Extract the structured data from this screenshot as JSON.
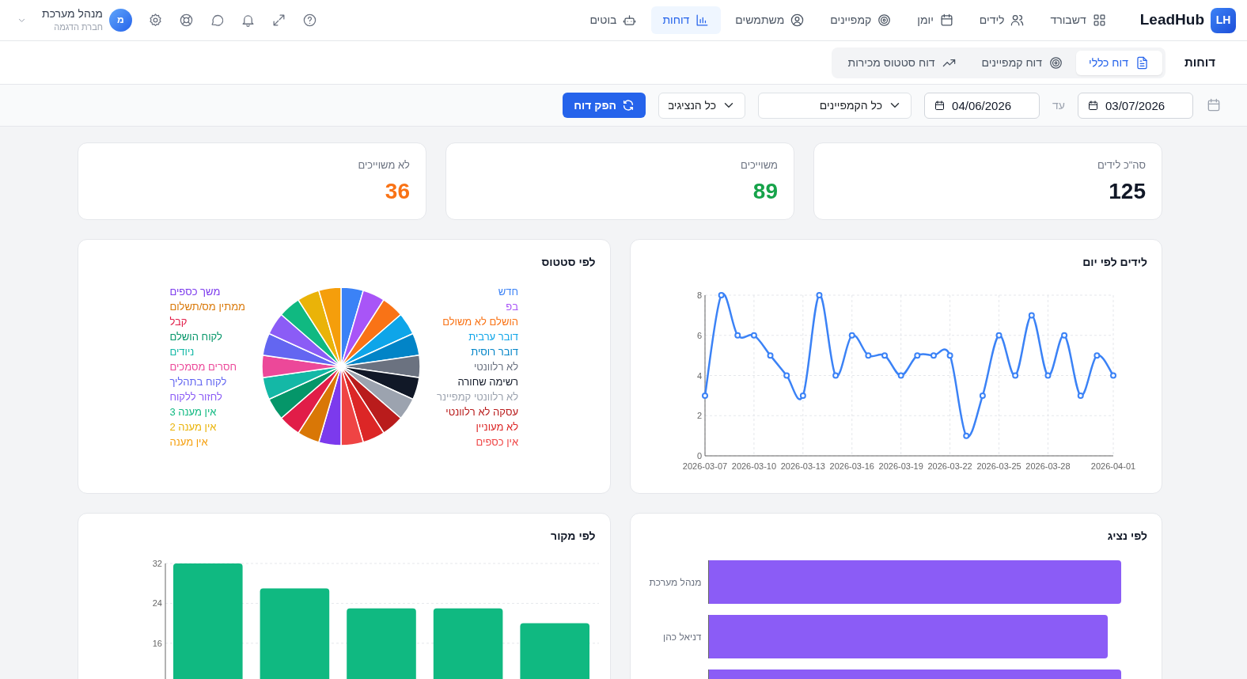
{
  "brand": {
    "badge": "LH",
    "name": "LeadHub"
  },
  "nav": [
    {
      "label": "דשבורד",
      "selected": false
    },
    {
      "label": "לידים",
      "selected": false
    },
    {
      "label": "יומן",
      "selected": false
    },
    {
      "label": "קמפיינים",
      "selected": false
    },
    {
      "label": "משתמשים",
      "selected": false
    },
    {
      "label": "דוחות",
      "selected": true
    },
    {
      "label": "בוטים",
      "selected": false
    }
  ],
  "user": {
    "avatar": "מ",
    "name": "מנהל מערכת",
    "company": "חברת הדגמה"
  },
  "page_title": "דוחות",
  "report_tabs": [
    {
      "label": "דוח כללי",
      "selected": true
    },
    {
      "label": "דוח קמפיינים",
      "selected": false
    },
    {
      "label": "דוח סטטוס מכירות",
      "selected": false
    }
  ],
  "filters": {
    "from": "03/07/2026",
    "to_label": "עד",
    "to": "04/06/2026",
    "campaign": "כל הקמפיינים",
    "rep": "כל הנציגים",
    "submit": "הפק דוח"
  },
  "stats": [
    {
      "label": "סה\"כ לידים",
      "value": "125",
      "color": "#111827"
    },
    {
      "label": "משוייכים",
      "value": "89",
      "color": "#16a34a"
    },
    {
      "label": "לא משוייכים",
      "value": "36",
      "color": "#f97316"
    }
  ],
  "leads_by_day": {
    "title": "לידים לפי יום",
    "chart_data": {
      "type": "line",
      "x": [
        "2026-03-07",
        "2026-03-08",
        "2026-03-09",
        "2026-03-10",
        "2026-03-11",
        "2026-03-12",
        "2026-03-13",
        "2026-03-14",
        "2026-03-15",
        "2026-03-16",
        "2026-03-17",
        "2026-03-18",
        "2026-03-19",
        "2026-03-20",
        "2026-03-21",
        "2026-03-22",
        "2026-03-23",
        "2026-03-24",
        "2026-03-25",
        "2026-03-26",
        "2026-03-27",
        "2026-03-28",
        "2026-03-29",
        "2026-03-30",
        "2026-03-31",
        "2026-04-01"
      ],
      "series": [
        {
          "color": "#3b82f6",
          "marker": "circle",
          "values": [
            3,
            8,
            6,
            6,
            5,
            4,
            3,
            8,
            4,
            6,
            5,
            5,
            4,
            5,
            5,
            5,
            1,
            3,
            6,
            4,
            7,
            4,
            6,
            3,
            5,
            4
          ]
        }
      ],
      "xticks": [
        "2026-03-07",
        "2026-03-10",
        "2026-03-13",
        "2026-03-16",
        "2026-03-19",
        "2026-03-22",
        "2026-03-25",
        "2026-03-28",
        "2026-04-01"
      ],
      "xlim": [
        "2026-03-07",
        "2026-04-01"
      ],
      "yticks": [
        0,
        2,
        4,
        6,
        8
      ],
      "ylim": [
        0,
        8
      ],
      "grid": true
    }
  },
  "by_status": {
    "title": "לפי סטטוס",
    "slices": [
      {
        "label": "חדש",
        "color": "#3b82f6"
      },
      {
        "label": "בפ",
        "color": "#a855f7"
      },
      {
        "label": "הושלם לא משולם",
        "color": "#f97316"
      },
      {
        "label": "דובר ערבית",
        "color": "#0ea5e9"
      },
      {
        "label": "דובר רוסית",
        "color": "#0284c7"
      },
      {
        "label": "לא רלוונטי",
        "color": "#6b7280"
      },
      {
        "label": "רשימה שחורה",
        "color": "#111827"
      },
      {
        "label": "לא רלוונטי קמפיינר",
        "color": "#9ca3af"
      },
      {
        "label": "עסקה לא רלוונטי",
        "color": "#b91c1c"
      },
      {
        "label": "לא מעוניין",
        "color": "#dc2626"
      },
      {
        "label": "אין כספים",
        "color": "#ef4444"
      },
      {
        "label": "משך כספים",
        "color": "#7c3aed"
      },
      {
        "label": "ממתין מס/תשלום",
        "color": "#d97706"
      },
      {
        "label": "קבל",
        "color": "#e11d48"
      },
      {
        "label": "לקוח הושלם",
        "color": "#059669"
      },
      {
        "label": "ניודים",
        "color": "#14b8a6"
      },
      {
        "label": "חסרים מסמכים",
        "color": "#ec4899"
      },
      {
        "label": "לקוח בתהליך",
        "color": "#6366f1"
      },
      {
        "label": "לחזור ללקוח",
        "color": "#8b5cf6"
      },
      {
        "label": "אין מענה 3",
        "color": "#10b981"
      },
      {
        "label": "אין מענה 2",
        "color": "#eab308"
      },
      {
        "label": "אין מענה",
        "color": "#f59e0b"
      }
    ]
  },
  "by_rep": {
    "title": "לפי נציג",
    "bars": [
      {
        "label": "מנהל מערכת",
        "level": 0.94
      },
      {
        "label": "דניאל כהן",
        "level": 0.91
      },
      {
        "level": 0.94
      }
    ]
  },
  "by_source": {
    "title": "לפי מקור",
    "chart_data": {
      "type": "bar",
      "series": [
        {
          "color": "#10b981",
          "values": [
            32,
            27,
            23,
            23,
            20
          ]
        }
      ],
      "yticks": [
        16,
        24,
        32
      ],
      "ylim": [
        0,
        32
      ],
      "grid": true
    }
  }
}
